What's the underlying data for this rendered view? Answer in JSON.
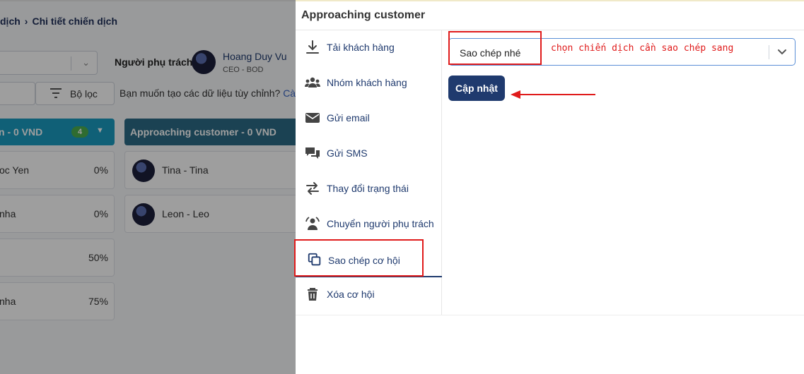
{
  "background": {
    "breadcrumb": {
      "prev": "dịch",
      "current": "Chi tiết chiến dịch"
    },
    "owner": {
      "label": "Người phụ trách",
      "name": "Hoang Duy Vu",
      "role": "CEO - BOD"
    },
    "filter_label": "Bộ lọc",
    "custom_question": "Bạn muốn tạo các dữ liệu tùy chỉnh?",
    "custom_link": "Cà",
    "columns": [
      {
        "title": "n - 0 VND",
        "count": "4"
      },
      {
        "title": "Approaching customer - 0 VND"
      }
    ],
    "cards_col1": [
      {
        "name": "oc Yen",
        "percent": "0%"
      },
      {
        "name": "nha",
        "percent": "0%"
      },
      {
        "name": "",
        "percent": "50%"
      },
      {
        "name": "nha",
        "percent": "75%"
      }
    ],
    "cards_col2": [
      {
        "name": "Tina - Tina"
      },
      {
        "name": "Leon - Leo"
      }
    ]
  },
  "panel": {
    "title": "Approaching customer",
    "menu": [
      {
        "label": "Tải khách hàng",
        "icon": "download-icon"
      },
      {
        "label": "Nhóm khách hàng",
        "icon": "users-icon"
      },
      {
        "label": "Gửi email",
        "icon": "envelope-icon"
      },
      {
        "label": "Gửi SMS",
        "icon": "chat-icon"
      },
      {
        "label": "Thay đổi trạng thái",
        "icon": "swap-icon"
      },
      {
        "label": "Chuyển người phụ trách",
        "icon": "user-transfer-icon"
      },
      {
        "label": "Sao chép cơ hội",
        "icon": "copy-icon",
        "active": true
      },
      {
        "label": "Xóa cơ hội",
        "icon": "trash-icon"
      }
    ],
    "select_value": "Sao chép nhé",
    "annotation": "chọn chiến dịch cần sao chép sang",
    "update_button": "Cập nhật"
  },
  "colors": {
    "primary": "#1f3a6e",
    "annotation_red": "#e01b1b",
    "column_teal": "#1a9bc0",
    "column_dark": "#2c6b86"
  }
}
